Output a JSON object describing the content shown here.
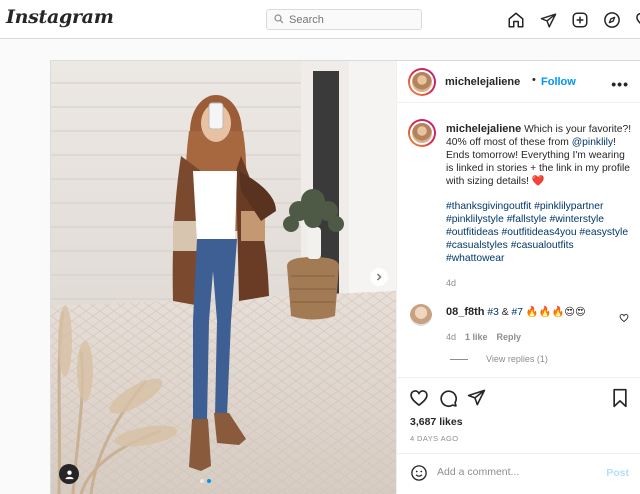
{
  "app": {
    "logo": "Instagram"
  },
  "search": {
    "placeholder": "Search"
  },
  "nav": [
    "home-icon",
    "direct-icon",
    "new-post-icon",
    "explore-icon",
    "activity-icon"
  ],
  "post": {
    "username": "michelejaliene",
    "follow_label": "Follow",
    "caption_user": "michelejaliene",
    "caption_1": " Which is your favorite?! 40% off most of these from ",
    "caption_mention": "@pinklily",
    "caption_2": "! Ends tomorrow! Everything I'm wearing is linked in stories + the link in my profile with sizing details! ",
    "caption_emoji": "❤️",
    "hashtags": [
      "#thanksgivingoutfit",
      "#pinklilypartner",
      "#pinklilystyle",
      "#fallstyle",
      "#winterstyle",
      "#outfitideas",
      "#outfitideas4you",
      "#easystyle",
      "#casualstyles",
      "#casualoutfits",
      "#whattowear"
    ],
    "caption_age": "4d",
    "likes": "3,687 likes",
    "posted_ago": "4 DAYS AGO",
    "photo_dots": 2,
    "active_dot": 1
  },
  "comment": {
    "user": "08_f8th",
    "text_1": " ",
    "tag_a": "#3",
    "mid": " & ",
    "tag_b": "#7",
    "emoji": " 🔥🔥🔥😍😍",
    "age": "4d",
    "likes": "1 like",
    "reply_label": "Reply",
    "view_replies": "View replies (1)"
  },
  "add_comment": {
    "placeholder": "Add a comment...",
    "post_label": "Post"
  },
  "colors": {
    "link": "#00376b",
    "accent": "#0095f6",
    "post_disabled": "#b2dffc"
  }
}
